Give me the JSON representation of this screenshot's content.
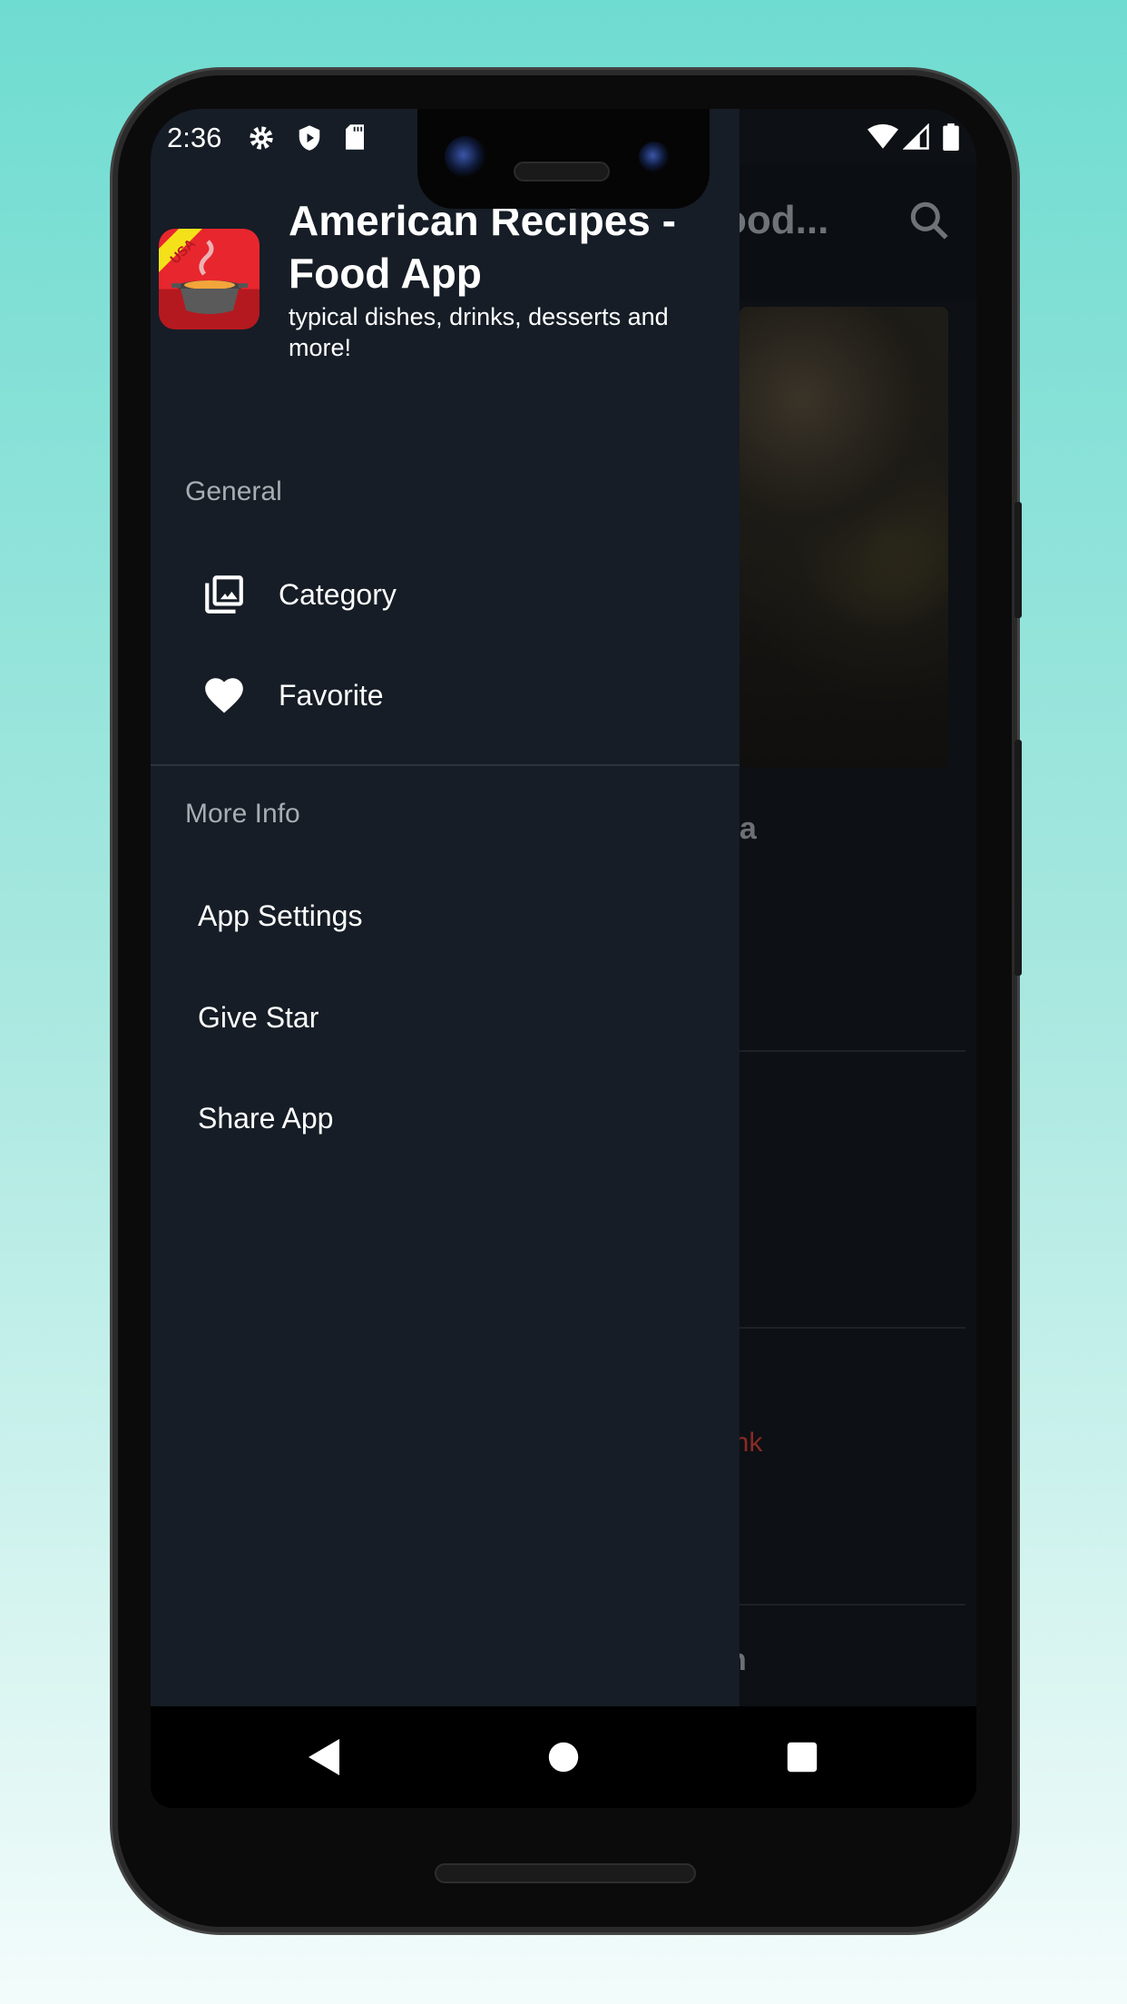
{
  "status_bar": {
    "time": "2:36",
    "icons": [
      "gear-icon",
      "shield-play-icon",
      "sd-card-icon",
      "wifi-icon",
      "signal-icon",
      "battery-icon"
    ]
  },
  "background_screen": {
    "toolbar_title": "ood...",
    "list_fragments": [
      "ea",
      "ink",
      "n"
    ],
    "accent_color": "#8a2a24"
  },
  "drawer": {
    "header": {
      "title": "American Recipes - Food App",
      "subtitle": "typical dishes, drinks, desserts and more!",
      "icon_text": "USA"
    },
    "sections": [
      {
        "label": "General",
        "items": [
          {
            "label": "Category",
            "icon": "photo-library-icon"
          },
          {
            "label": "Favorite",
            "icon": "heart-icon"
          }
        ]
      },
      {
        "label": "More Info",
        "items": [
          {
            "label": "App Settings"
          },
          {
            "label": "Give Star"
          },
          {
            "label": "Share App"
          }
        ]
      }
    ]
  },
  "nav_bar": {
    "buttons": [
      "back",
      "home",
      "recents"
    ]
  }
}
